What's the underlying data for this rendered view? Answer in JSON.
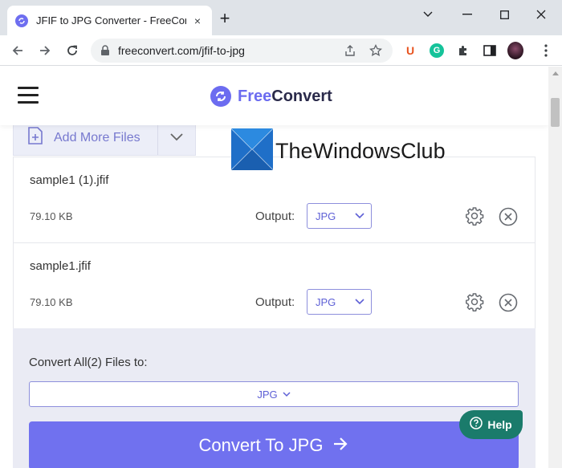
{
  "browser": {
    "tab_title": "JFIF to JPG Converter - FreeConvert",
    "tab_close": "×",
    "new_tab": "+",
    "url": "freeconvert.com/jfif-to-jpg",
    "extension_u_label": "U",
    "extension_g_label": "G"
  },
  "site": {
    "logo_free": "Free",
    "logo_convert": "Convert",
    "add_more_files": "Add More Files"
  },
  "watermark": {
    "text": "TheWindowsClub"
  },
  "files": [
    {
      "name": "sample1 (1).jfif",
      "size": "79.10 KB",
      "output_label": "Output:",
      "format": "JPG"
    },
    {
      "name": "sample1.jfif",
      "size": "79.10 KB",
      "output_label": "Output:",
      "format": "JPG"
    }
  ],
  "convert_all": {
    "label": "Convert All(2) Files to:",
    "format": "JPG",
    "button_label": "Convert To JPG"
  },
  "help": {
    "label": "Help"
  },
  "colors": {
    "accent": "#7071ef",
    "help_green": "#1a7b6b",
    "titlebar": "#dfe3e8"
  },
  "icons": [
    "back-icon",
    "forward-icon",
    "reload-icon",
    "lock-icon",
    "share-icon",
    "star-icon",
    "puzzle-icon",
    "sidepanel-icon",
    "more-icon",
    "menu-icon",
    "gear-icon",
    "close-icon",
    "chevron-down-icon",
    "arrow-right-icon",
    "help-icon"
  ]
}
